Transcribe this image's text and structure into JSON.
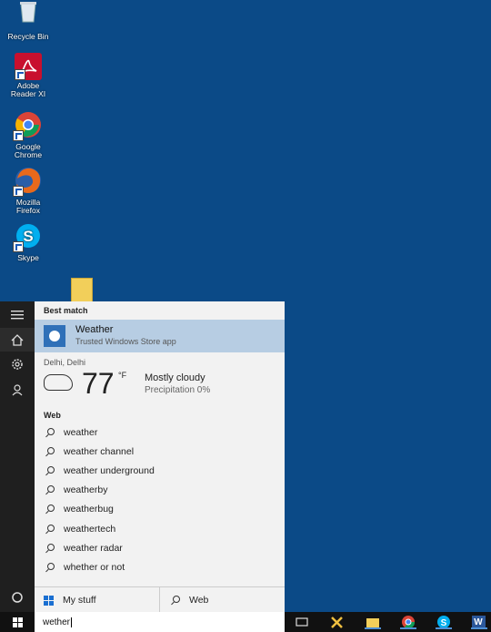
{
  "desktop": {
    "icons": [
      {
        "label_lines": [
          "Recycle Bin"
        ]
      },
      {
        "label_lines": [
          "Adobe",
          "Reader XI"
        ]
      },
      {
        "label_lines": [
          "Google",
          "Chrome"
        ]
      },
      {
        "label_lines": [
          "Mozilla",
          "Firefox"
        ]
      },
      {
        "label_lines": [
          "Skype"
        ]
      }
    ]
  },
  "search": {
    "best_match_header": "Best match",
    "best_match": {
      "title": "Weather",
      "subtitle": "Trusted Windows Store app"
    },
    "weather": {
      "location": "Delhi, Delhi",
      "temperature": "77",
      "unit": "°F",
      "condition": "Mostly cloudy",
      "precipitation": "Precipitation 0%"
    },
    "web_header": "Web",
    "web_results": [
      "weather",
      "weather channel",
      "weather underground",
      "weatherby",
      "weatherbug",
      "weathertech",
      "weather radar",
      "whether or not"
    ],
    "my_stuff_label": "My stuff",
    "web_label": "Web",
    "query": "wether"
  }
}
